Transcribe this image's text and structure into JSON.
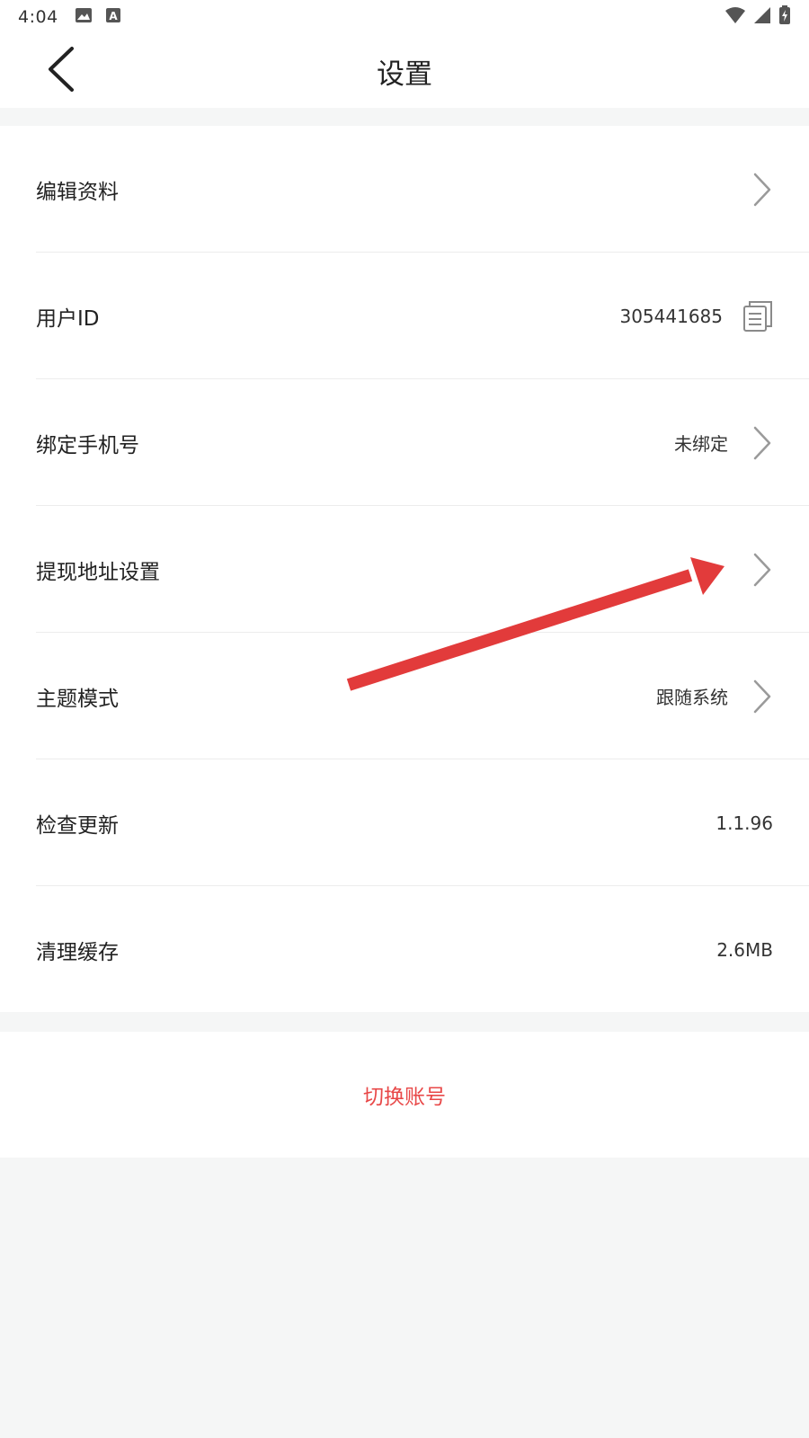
{
  "status_bar": {
    "time": "4:04",
    "left_icons": [
      "image-icon",
      "font-a-icon"
    ],
    "right_icons": [
      "wifi-icon",
      "signal-icon",
      "battery-charging-icon"
    ]
  },
  "header": {
    "title": "设置",
    "back_icon": "chevron-left-icon"
  },
  "settings": {
    "rows": [
      {
        "label": "编辑资料",
        "value": "",
        "trailing": "chevron-right-icon"
      },
      {
        "label": "用户ID",
        "value": "305441685",
        "trailing": "copy-icon"
      },
      {
        "label": "绑定手机号",
        "value": "未绑定",
        "trailing": "chevron-right-icon"
      },
      {
        "label": "提现地址设置",
        "value": "",
        "trailing": "chevron-right-icon"
      },
      {
        "label": "主题模式",
        "value": "跟随系统",
        "trailing": "chevron-right-icon"
      },
      {
        "label": "检查更新",
        "value": "1.1.96",
        "trailing": ""
      },
      {
        "label": "清理缓存",
        "value": "2.6MB",
        "trailing": ""
      }
    ]
  },
  "switch_account": {
    "label": "切换账号",
    "color": "#e84848"
  },
  "colors": {
    "background": "#f5f6f6",
    "card": "#ffffff",
    "divider": "#ececec",
    "annotation_arrow": "#e23b3b"
  }
}
